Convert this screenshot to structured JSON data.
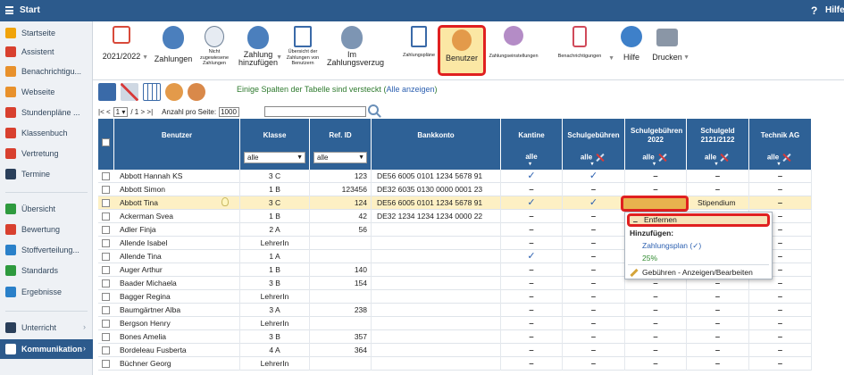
{
  "titlebar": {
    "title": "Start",
    "help_label": "Hilfe",
    "help_icon": "?"
  },
  "sidebar": {
    "items": [
      {
        "label": "Startseite",
        "icon": "star-icon",
        "color": "#f0a30a"
      },
      {
        "label": "Assistent",
        "icon": "assistant-icon",
        "color": "#d8402f"
      },
      {
        "label": "Benachrichtigu...",
        "icon": "mail-icon",
        "color": "#e8912c"
      },
      {
        "label": "Webseite",
        "icon": "web-icon",
        "color": "#e8912c"
      },
      {
        "label": "Stundenpläne ...",
        "icon": "timetable-icon",
        "color": "#d8402f"
      },
      {
        "label": "Klassenbuch",
        "icon": "book-icon",
        "color": "#d8402f"
      },
      {
        "label": "Vertretung",
        "icon": "substitute-icon",
        "color": "#d8402f"
      },
      {
        "label": "Termine",
        "icon": "calendar-icon",
        "color": "#2a3f5a"
      },
      {
        "label": "Übersicht",
        "icon": "overview-icon",
        "color": "#2e9a3e"
      },
      {
        "label": "Bewertung",
        "icon": "rating-icon",
        "color": "#d8402f"
      },
      {
        "label": "Stoffverteilung...",
        "icon": "material-icon",
        "color": "#2a80c9"
      },
      {
        "label": "Standards",
        "icon": "shield-icon",
        "color": "#2e9a3e"
      },
      {
        "label": "Ergebnisse",
        "icon": "results-icon",
        "color": "#2a80c9"
      },
      {
        "label": "Unterricht",
        "icon": "lesson-icon",
        "color": "#2a3f5a",
        "chevron": "›"
      },
      {
        "label": "Kommunikation",
        "icon": "communication-icon",
        "color": "#ffffff",
        "chevron": "›",
        "active": true
      }
    ]
  },
  "toolbar": {
    "year_label": "2021/2022",
    "zahlungen": "Zahlungen",
    "nicht_zugewiesen": "Nicht zugewiesene Zahlungen",
    "zahlung_hinzufuegen": "Zahlung hinzufügen",
    "uebersicht": "Übersicht der Zahlungen von Benutzern",
    "im_zahlungsverzug": "Im Zahlungsverzug",
    "zahlungsplaene": "Zahlungspläne",
    "benutzer": "Benutzer",
    "zahlungseinstellungen": "Zahlungseinstellungen",
    "benachrichtigungen": "Benachrichtigungen",
    "hilfe": "Hilfe",
    "drucken": "Drucken",
    "arrow": "▼"
  },
  "actionbar": {
    "hint": "Einige Spalten der Tabelle sind versteckt",
    "hint_link": "Alle anzeigen",
    "hint_open": "(",
    "hint_close": ")"
  },
  "pager": {
    "prev": "|< <",
    "page": "1",
    "of": "/ 1",
    "next": "> >|",
    "per_page_label": "Anzahl pro Seite:",
    "per_page_value": "1000"
  },
  "columns": {
    "benutzer": "Benutzer",
    "klasse": "Klasse",
    "ref_id": "Ref. ID",
    "bankkonto": "Bankkonto",
    "kantine": "Kantine",
    "schulgebuehren": "Schulgebühren",
    "schulgebuehren_2022": "Schulgebühren 2022",
    "schulgeld": "Schulgeld 2121/2122",
    "technik_ag": "Technik AG",
    "filter_value": "alle",
    "dropdown_arrow": "▼",
    "caret": "▾"
  },
  "rows": [
    {
      "name": "Abbott Hannah KS",
      "klasse": "3 C",
      "ref": "123",
      "bank": "DE56 6005 0101 1234 5678 91",
      "kantine": "✓",
      "schulgeb": "✓",
      "schulgeb22": "‒",
      "schulgeld": "‒",
      "technik": "‒"
    },
    {
      "name": "Abbott Simon",
      "klasse": "1 B",
      "ref": "123456",
      "bank": "DE32 6035 0130 0000 0001 23",
      "kantine": "‒",
      "schulgeb": "‒",
      "schulgeb22": "‒",
      "schulgeld": "‒",
      "technik": "‒"
    },
    {
      "name": "Abbott Tina",
      "klasse": "3 C",
      "ref": "124",
      "bank": "DE56 6005 0101 1234 5678 91",
      "kantine": "✓",
      "schulgeb": "✓",
      "schulgeb22": "✓",
      "schulgeld": "Stipendium",
      "technik": "‒",
      "selected": true
    },
    {
      "name": "Ackerman Svea",
      "klasse": "1 B",
      "ref": "42",
      "bank": "DE32 1234 1234 1234 0000 22",
      "kantine": "‒",
      "schulgeb": "‒",
      "schulgeb22": "",
      "schulgeld": "",
      "technik": "‒"
    },
    {
      "name": "Adler Finja",
      "klasse": "2 A",
      "ref": "56",
      "bank": "",
      "kantine": "‒",
      "schulgeb": "‒",
      "schulgeb22": "",
      "schulgeld": "",
      "technik": "‒"
    },
    {
      "name": "Allende Isabel",
      "klasse": "LehrerIn",
      "ref": "",
      "bank": "",
      "kantine": "‒",
      "schulgeb": "‒",
      "schulgeb22": "",
      "schulgeld": "",
      "technik": "‒"
    },
    {
      "name": "Allende Tina",
      "klasse": "1 A",
      "ref": "",
      "bank": "",
      "kantine": "✓",
      "schulgeb": "‒",
      "schulgeb22": "",
      "schulgeld": "",
      "technik": "‒"
    },
    {
      "name": "Auger Arthur",
      "klasse": "1 B",
      "ref": "140",
      "bank": "",
      "kantine": "‒",
      "schulgeb": "‒",
      "schulgeb22": "",
      "schulgeld": "",
      "technik": "‒"
    },
    {
      "name": "Baader Michaela",
      "klasse": "3 B",
      "ref": "154",
      "bank": "",
      "kantine": "‒",
      "schulgeb": "‒",
      "schulgeb22": "‒",
      "schulgeld": "‒",
      "technik": "‒"
    },
    {
      "name": "Bagger Regina",
      "klasse": "LehrerIn",
      "ref": "",
      "bank": "",
      "kantine": "‒",
      "schulgeb": "‒",
      "schulgeb22": "‒",
      "schulgeld": "‒",
      "technik": "‒"
    },
    {
      "name": "Baumgärtner Alba",
      "klasse": "3 A",
      "ref": "238",
      "bank": "",
      "kantine": "‒",
      "schulgeb": "‒",
      "schulgeb22": "‒",
      "schulgeld": "‒",
      "technik": "‒"
    },
    {
      "name": "Bergson Henry",
      "klasse": "LehrerIn",
      "ref": "",
      "bank": "",
      "kantine": "‒",
      "schulgeb": "‒",
      "schulgeb22": "‒",
      "schulgeld": "‒",
      "technik": "‒"
    },
    {
      "name": "Bones Amelia",
      "klasse": "3 B",
      "ref": "357",
      "bank": "",
      "kantine": "‒",
      "schulgeb": "‒",
      "schulgeb22": "‒",
      "schulgeld": "‒",
      "technik": "‒"
    },
    {
      "name": "Bordeleau Fusberta",
      "klasse": "4 A",
      "ref": "364",
      "bank": "",
      "kantine": "‒",
      "schulgeb": "‒",
      "schulgeb22": "‒",
      "schulgeld": "‒",
      "technik": "‒"
    },
    {
      "name": "Büchner Georg",
      "klasse": "LehrerIn",
      "ref": "",
      "bank": "",
      "kantine": "‒",
      "schulgeb": "‒",
      "schulgeb22": "‒",
      "schulgeld": "‒",
      "technik": "‒"
    }
  ],
  "popup": {
    "dash": "‒",
    "remove": "Entfernen",
    "add_header": "Hinzufügen:",
    "payment_plan": "Zahlungsplan (✓)",
    "percent": "25%",
    "fees": "Gebühren - Anzeigen/Bearbeiten"
  },
  "colors": {
    "header_blue": "#2e6196",
    "titlebar_blue": "#2c5a8c",
    "check_blue": "#2b5fb0",
    "check_green": "#2e8a2e",
    "highlight_red": "#e02020"
  }
}
